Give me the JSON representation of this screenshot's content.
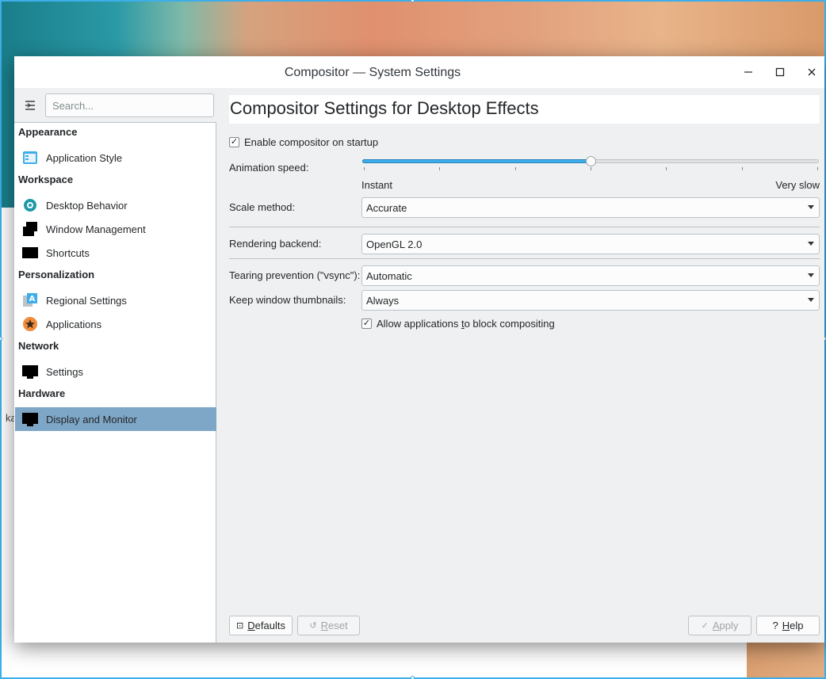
{
  "window": {
    "title": "Compositor — System Settings"
  },
  "background": {
    "partial_text": "ka"
  },
  "sidebar": {
    "search_placeholder": "Search...",
    "categories": [
      {
        "label": "Appearance",
        "items": [
          {
            "label": "Application Style",
            "icon": "application-style-icon"
          }
        ]
      },
      {
        "label": "Workspace",
        "items": [
          {
            "label": "Desktop Behavior",
            "icon": "desktop-behavior-icon"
          },
          {
            "label": "Window Management",
            "icon": "window-management-icon"
          },
          {
            "label": "Shortcuts",
            "icon": "shortcuts-icon"
          }
        ]
      },
      {
        "label": "Personalization",
        "items": [
          {
            "label": "Regional Settings",
            "icon": "regional-settings-icon"
          },
          {
            "label": "Applications",
            "icon": "applications-star-icon"
          }
        ]
      },
      {
        "label": "Network",
        "items": [
          {
            "label": "Settings",
            "icon": "network-settings-icon"
          }
        ]
      },
      {
        "label": "Hardware",
        "items": [
          {
            "label": "Display and Monitor",
            "icon": "display-monitor-icon",
            "selected": true
          }
        ]
      }
    ]
  },
  "main": {
    "heading": "Compositor Settings for Desktop Effects",
    "enable_on_startup": {
      "label": "Enable compositor on startup",
      "checked": true
    },
    "animation_speed": {
      "label": "Animation speed:",
      "min_label": "Instant",
      "max_label": "Very slow",
      "value_fraction": 0.5,
      "tick_count": 7
    },
    "scale_method": {
      "label": "Scale method:",
      "value": "Accurate"
    },
    "rendering_backend": {
      "label": "Rendering backend:",
      "value": "OpenGL 2.0"
    },
    "tearing_prevention": {
      "label": "Tearing prevention (\"vsync\"):",
      "value": "Automatic"
    },
    "keep_thumbnails": {
      "label": "Keep window thumbnails:",
      "value": "Always"
    },
    "allow_block": {
      "label_before": "Allow applications ",
      "label_accel": "t",
      "label_after": "o block compositing",
      "checked": true
    }
  },
  "buttons": {
    "defaults": {
      "accel": "D",
      "rest": "efaults"
    },
    "reset": {
      "accel": "R",
      "rest": "eset",
      "disabled": true
    },
    "apply": {
      "accel": "A",
      "rest": "pply",
      "disabled": true
    },
    "help": {
      "accel": "H",
      "rest": "elp"
    }
  },
  "colors": {
    "accent": "#3daee9",
    "selection": "#7ea7c7",
    "window_bg": "#eff0f1"
  }
}
